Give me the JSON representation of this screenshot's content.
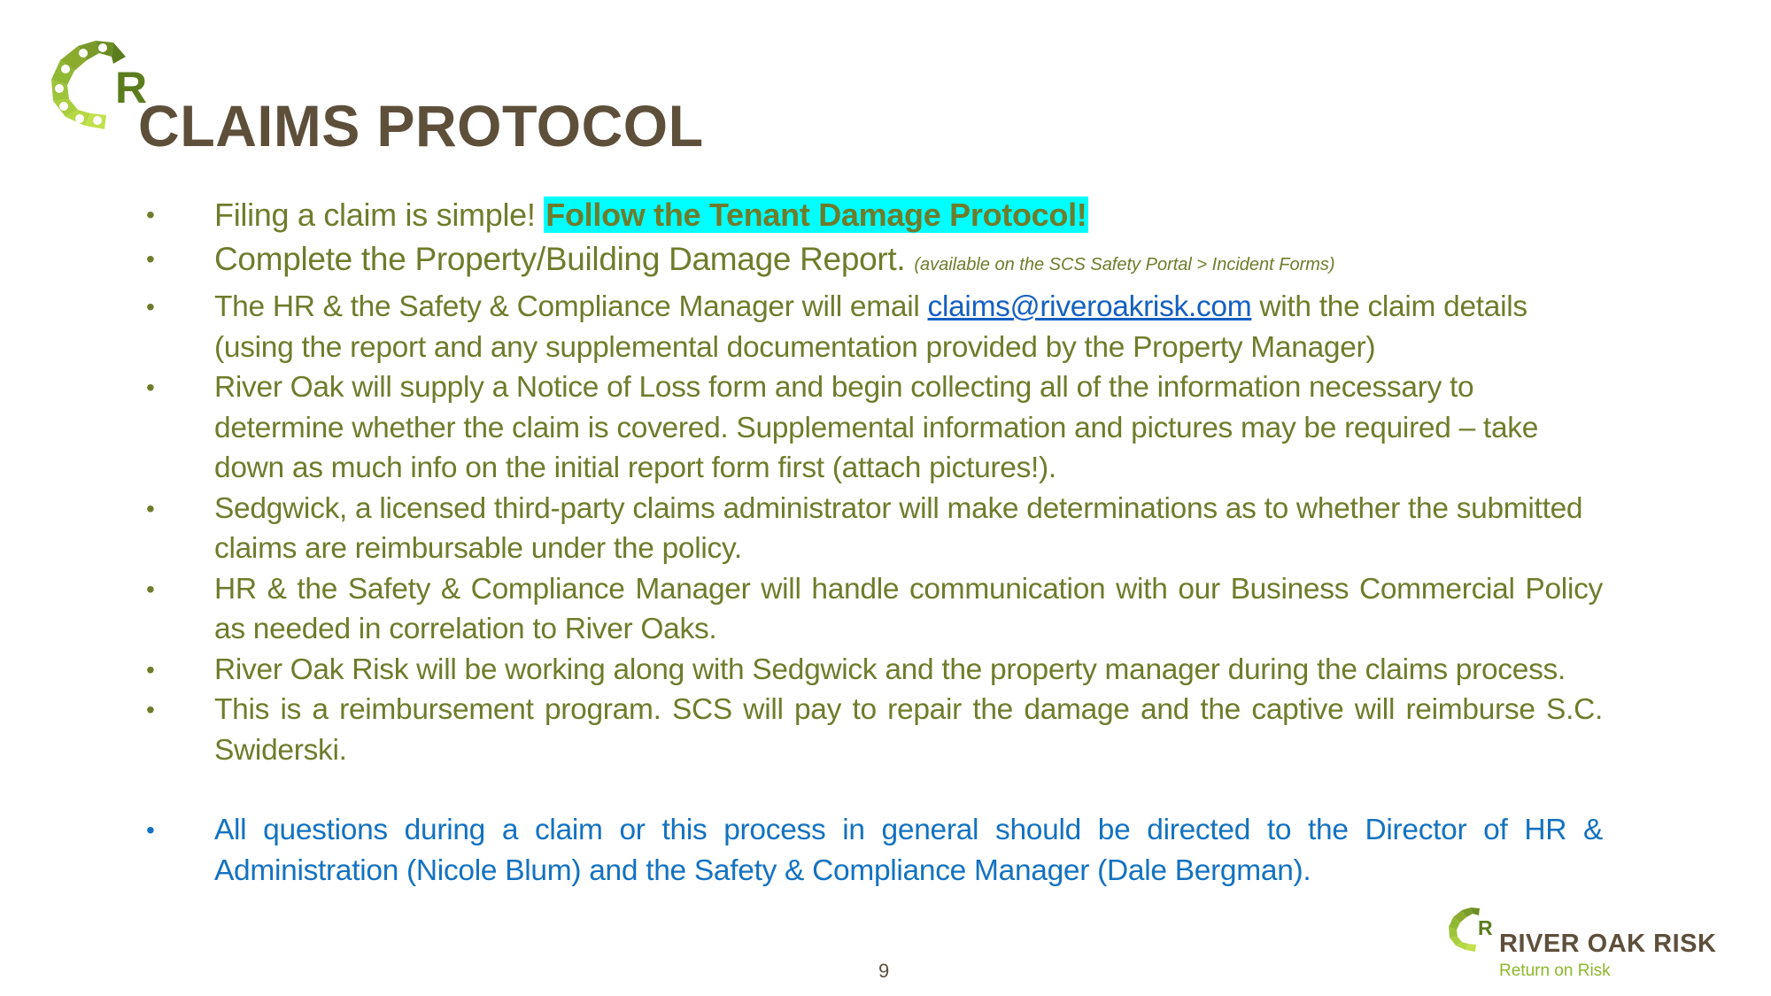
{
  "slide": {
    "title": "CLAIMS PROTOCOL",
    "page_number": "9",
    "colors": {
      "title": "#5e4f3b",
      "body_text": "#6e7c2b",
      "highlight_bg": "#00ffff",
      "link": "#1460c0",
      "contact_text": "#1372c1",
      "tagline": "#8cb82a"
    }
  },
  "bullets": [
    {
      "text_before": "Filing a claim is simple! ",
      "highlight": "Follow the Tenant Damage Protocol!"
    },
    {
      "text": "Complete the Property/Building Damage Report. ",
      "note": "(available on the SCS Safety Portal > Incident Forms)"
    },
    {
      "text_before": "The HR & the Safety & Compliance Manager will email ",
      "link": "claims@riveroakrisk.com",
      "text_after": " with the claim details (using the report and any supplemental documentation provided by the Property Manager)"
    },
    {
      "text": "River Oak will supply a Notice of Loss form and begin collecting all of the information necessary to determine whether the claim is covered. Supplemental information and pictures may be required – take down as much info on the initial report form first (attach pictures!)."
    },
    {
      "text": "Sedgwick, a licensed third-party claims administrator will make determinations as to whether the submitted claims are reimbursable under the policy."
    },
    {
      "text": "HR & the Safety & Compliance Manager will handle communication with our Business Commercial Policy as needed in correlation to River Oaks."
    },
    {
      "text": "River Oak Risk will be working along with Sedgwick and the property manager during the claims process."
    },
    {
      "text": "This is a reimbursement program. SCS will pay to repair the damage and the captive will reimburse S.C. Swiderski."
    },
    {
      "text": "All questions during a claim or this process in general should be directed to the Director of HR & Administration (Nicole Blum) and the Safety & Compliance Manager (Dale Bergman)."
    }
  ],
  "bullet_glyph": "•",
  "footer": {
    "brand": "RIVER OAK RISK",
    "tagline": "Return on Risk",
    "logo_letter": "R",
    "logo_icon": "river-oak-rosette-logo"
  },
  "header_logo": {
    "letter": "R",
    "icon": "river-oak-rosette-logo"
  }
}
